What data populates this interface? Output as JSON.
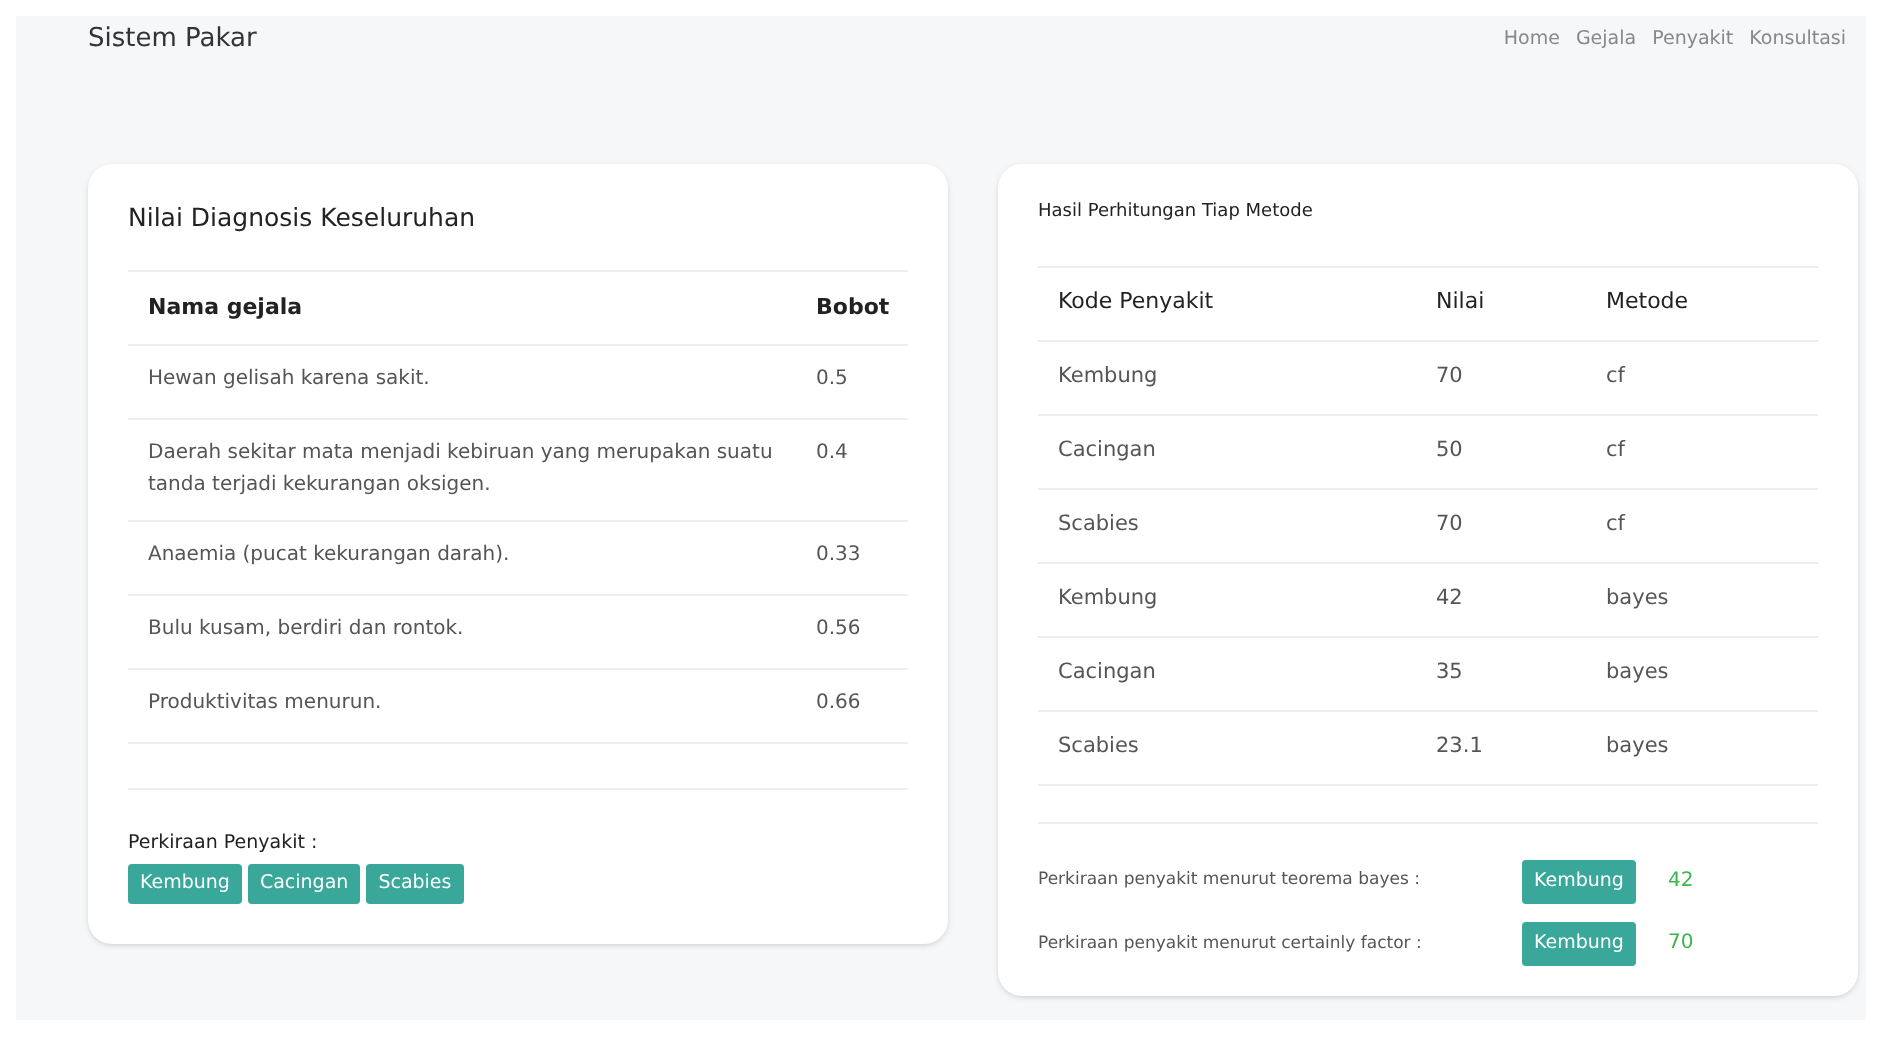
{
  "navbar": {
    "brand": "Sistem Pakar",
    "links": [
      "Home",
      "Gejala",
      "Penyakit",
      "Konsultasi"
    ]
  },
  "diagnosis": {
    "title": "Nilai Diagnosis Keseluruhan",
    "columns": [
      "Nama gejala",
      "Bobot"
    ],
    "rows": [
      [
        "Hewan gelisah karena sakit.",
        "0.5"
      ],
      [
        "Daerah sekitar mata menjadi kebiruan yang merupakan suatu tanda terjadi kekurangan oksigen.",
        "0.4"
      ],
      [
        "Anaemia (pucat kekurangan darah).",
        "0.33"
      ],
      [
        "Bulu kusam, berdiri dan rontok.",
        "0.56"
      ],
      [
        "Produktivitas menurun.",
        "0.66"
      ]
    ],
    "estimate_label": "Perkiraan Penyakit :",
    "tags": [
      "Kembung",
      "Cacingan",
      "Scabies"
    ]
  },
  "methods": {
    "title": "Hasil Perhitungan Tiap Metode",
    "columns": [
      "Kode Penyakit",
      "Nilai",
      "Metode"
    ],
    "rows": [
      [
        "Kembung",
        "70",
        "cf"
      ],
      [
        "Cacingan",
        "50",
        "cf"
      ],
      [
        "Scabies",
        "70",
        "cf"
      ],
      [
        "Kembung",
        "42",
        "bayes"
      ],
      [
        "Cacingan",
        "35",
        "bayes"
      ],
      [
        "Scabies",
        "23.1",
        "bayes"
      ]
    ],
    "results": [
      {
        "label": "Perkiraan penyakit menurut teorema bayes :",
        "tag": "Kembung",
        "value": "42"
      },
      {
        "label": "Perkiraan penyakit menurut certainly factor :",
        "tag": "Kembung",
        "value": "70"
      }
    ]
  }
}
